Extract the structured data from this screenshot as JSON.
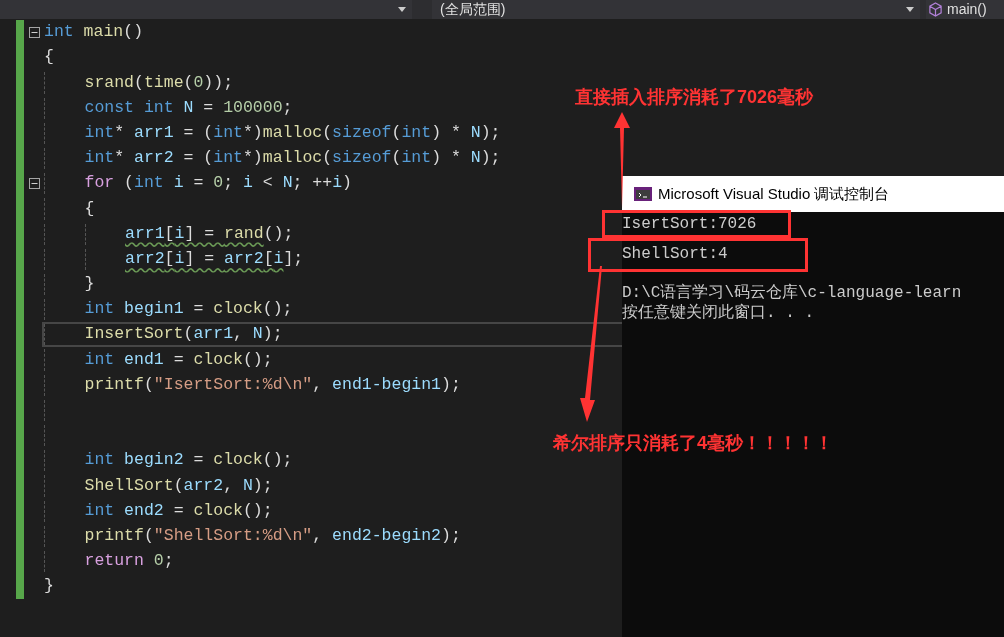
{
  "toolbar": {
    "scope": "(全局范围)",
    "member": "main()"
  },
  "editor": {
    "lines": [
      {
        "kind": "code",
        "foldable": true,
        "tokens": [
          {
            "text": "int",
            "kind": "keyword"
          },
          {
            "text": " main",
            "kind": "function"
          },
          {
            "text": "()",
            "kind": "plain"
          }
        ]
      },
      {
        "kind": "code",
        "tokens": [
          {
            "text": "{",
            "kind": "plain"
          }
        ],
        "children": [
          {
            "kind": "code",
            "tokens": [
              {
                "text": "srand",
                "kind": "function"
              },
              {
                "text": "(",
                "kind": "plain"
              },
              {
                "text": "time",
                "kind": "function"
              },
              {
                "text": "(",
                "kind": "plain"
              },
              {
                "text": "0",
                "kind": "number"
              },
              {
                "text": "));",
                "kind": "plain"
              }
            ]
          },
          {
            "kind": "code",
            "tokens": [
              {
                "text": "const int",
                "kind": "keyword"
              },
              {
                "text": " N",
                "kind": "variable"
              },
              {
                "text": " = ",
                "kind": "plain"
              },
              {
                "text": "100000",
                "kind": "number"
              },
              {
                "text": ";",
                "kind": "plain"
              }
            ]
          },
          {
            "kind": "code",
            "tokens": [
              {
                "text": "int",
                "kind": "keyword"
              },
              {
                "text": "* ",
                "kind": "plain"
              },
              {
                "text": "arr1",
                "kind": "variable"
              },
              {
                "text": " = (",
                "kind": "plain"
              },
              {
                "text": "int",
                "kind": "keyword"
              },
              {
                "text": "*)",
                "kind": "plain"
              },
              {
                "text": "malloc",
                "kind": "function"
              },
              {
                "text": "(",
                "kind": "plain"
              },
              {
                "text": "sizeof",
                "kind": "keyword"
              },
              {
                "text": "(",
                "kind": "plain"
              },
              {
                "text": "int",
                "kind": "keyword"
              },
              {
                "text": ") * ",
                "kind": "plain"
              },
              {
                "text": "N",
                "kind": "variable"
              },
              {
                "text": ");",
                "kind": "plain"
              }
            ]
          },
          {
            "kind": "code",
            "tokens": [
              {
                "text": "int",
                "kind": "keyword"
              },
              {
                "text": "* ",
                "kind": "plain"
              },
              {
                "text": "arr2",
                "kind": "variable"
              },
              {
                "text": " = (",
                "kind": "plain"
              },
              {
                "text": "int",
                "kind": "keyword"
              },
              {
                "text": "*)",
                "kind": "plain"
              },
              {
                "text": "malloc",
                "kind": "function"
              },
              {
                "text": "(",
                "kind": "plain"
              },
              {
                "text": "sizeof",
                "kind": "keyword"
              },
              {
                "text": "(",
                "kind": "plain"
              },
              {
                "text": "int",
                "kind": "keyword"
              },
              {
                "text": ") * ",
                "kind": "plain"
              },
              {
                "text": "N",
                "kind": "variable"
              },
              {
                "text": ");",
                "kind": "plain"
              }
            ]
          },
          {
            "kind": "code",
            "foldable": true,
            "tokens": [
              {
                "text": "for",
                "kind": "control"
              },
              {
                "text": " (",
                "kind": "plain"
              },
              {
                "text": "int",
                "kind": "keyword"
              },
              {
                "text": " i",
                "kind": "variable"
              },
              {
                "text": " = ",
                "kind": "plain"
              },
              {
                "text": "0",
                "kind": "number"
              },
              {
                "text": "; ",
                "kind": "plain"
              },
              {
                "text": "i",
                "kind": "variable"
              },
              {
                "text": " < ",
                "kind": "plain"
              },
              {
                "text": "N",
                "kind": "variable"
              },
              {
                "text": "; ++",
                "kind": "plain"
              },
              {
                "text": "i",
                "kind": "variable"
              },
              {
                "text": ")",
                "kind": "plain"
              }
            ]
          },
          {
            "kind": "code",
            "tokens": [
              {
                "text": "{",
                "kind": "plain"
              }
            ],
            "children": [
              {
                "kind": "code",
                "warning": true,
                "tokens": [
                  {
                    "text": "arr1",
                    "kind": "variable"
                  },
                  {
                    "text": "[",
                    "kind": "plain"
                  },
                  {
                    "text": "i",
                    "kind": "variable"
                  },
                  {
                    "text": "] = ",
                    "kind": "plain"
                  },
                  {
                    "text": "rand",
                    "kind": "function"
                  },
                  {
                    "text": "();",
                    "kind": "plain"
                  }
                ]
              },
              {
                "kind": "code",
                "warning": true,
                "tokens": [
                  {
                    "text": "arr2",
                    "kind": "variable"
                  },
                  {
                    "text": "[",
                    "kind": "plain"
                  },
                  {
                    "text": "i",
                    "kind": "variable"
                  },
                  {
                    "text": "] = ",
                    "kind": "plain"
                  },
                  {
                    "text": "arr2",
                    "kind": "variable"
                  },
                  {
                    "text": "[",
                    "kind": "plain"
                  },
                  {
                    "text": "i",
                    "kind": "variable"
                  },
                  {
                    "text": "];",
                    "kind": "plain"
                  }
                ]
              }
            ]
          },
          {
            "kind": "code",
            "tokens": [
              {
                "text": "}",
                "kind": "plain"
              }
            ]
          },
          {
            "kind": "code",
            "tokens": [
              {
                "text": "int",
                "kind": "keyword"
              },
              {
                "text": " begin1",
                "kind": "variable"
              },
              {
                "text": " = ",
                "kind": "plain"
              },
              {
                "text": "clock",
                "kind": "function"
              },
              {
                "text": "();",
                "kind": "plain"
              }
            ]
          },
          {
            "kind": "code",
            "current": true,
            "tokens": [
              {
                "text": "InsertSort",
                "kind": "function"
              },
              {
                "text": "(",
                "kind": "plain"
              },
              {
                "text": "arr1",
                "kind": "variable"
              },
              {
                "text": ", ",
                "kind": "plain"
              },
              {
                "text": "N",
                "kind": "variable"
              },
              {
                "text": ");",
                "kind": "plain"
              }
            ]
          },
          {
            "kind": "code",
            "tokens": [
              {
                "text": "int",
                "kind": "keyword"
              },
              {
                "text": " end1",
                "kind": "variable"
              },
              {
                "text": " = ",
                "kind": "plain"
              },
              {
                "text": "clock",
                "kind": "function"
              },
              {
                "text": "();",
                "kind": "plain"
              }
            ]
          },
          {
            "kind": "code",
            "tokens": [
              {
                "text": "printf",
                "kind": "function"
              },
              {
                "text": "(",
                "kind": "plain"
              },
              {
                "text": "\"IsertSort:%d\\n\"",
                "kind": "string"
              },
              {
                "text": ", ",
                "kind": "plain"
              },
              {
                "text": "end1-begin1",
                "kind": "variable"
              },
              {
                "text": ");",
                "kind": "plain"
              }
            ]
          },
          {
            "kind": "blank"
          },
          {
            "kind": "blank"
          },
          {
            "kind": "code",
            "tokens": [
              {
                "text": "int",
                "kind": "keyword"
              },
              {
                "text": " begin2",
                "kind": "variable"
              },
              {
                "text": " = ",
                "kind": "plain"
              },
              {
                "text": "clock",
                "kind": "function"
              },
              {
                "text": "();",
                "kind": "plain"
              }
            ]
          },
          {
            "kind": "code",
            "tokens": [
              {
                "text": "ShellSort",
                "kind": "function"
              },
              {
                "text": "(",
                "kind": "plain"
              },
              {
                "text": "arr2",
                "kind": "variable"
              },
              {
                "text": ", ",
                "kind": "plain"
              },
              {
                "text": "N",
                "kind": "variable"
              },
              {
                "text": ");",
                "kind": "plain"
              }
            ]
          },
          {
            "kind": "code",
            "tokens": [
              {
                "text": "int",
                "kind": "keyword"
              },
              {
                "text": " end2",
                "kind": "variable"
              },
              {
                "text": " = ",
                "kind": "plain"
              },
              {
                "text": "clock",
                "kind": "function"
              },
              {
                "text": "();",
                "kind": "plain"
              }
            ]
          },
          {
            "kind": "code",
            "tokens": [
              {
                "text": "printf",
                "kind": "function"
              },
              {
                "text": "(",
                "kind": "plain"
              },
              {
                "text": "\"ShellSort:%d\\n\"",
                "kind": "string"
              },
              {
                "text": ", ",
                "kind": "plain"
              },
              {
                "text": "end2-begin2",
                "kind": "variable"
              },
              {
                "text": ");",
                "kind": "plain"
              }
            ]
          },
          {
            "kind": "code",
            "tokens": [
              {
                "text": "return",
                "kind": "control"
              },
              {
                "text": " 0",
                "kind": "number"
              },
              {
                "text": ";",
                "kind": "plain"
              }
            ]
          }
        ]
      },
      {
        "kind": "code",
        "tokens": [
          {
            "text": "}",
            "kind": "plain"
          }
        ]
      }
    ]
  },
  "console": {
    "title": "Microsoft Visual Studio 调试控制台",
    "blocks": [
      [
        "IsertSort:7026",
        "ShellSort:4"
      ],
      [
        "D:\\C语言学习\\码云仓库\\c-language-learn",
        "按任意键关闭此窗口. . ."
      ]
    ]
  },
  "annotations": {
    "top_note": "直接插入排序消耗了7026毫秒",
    "bottom_note": "希尔排序只消耗了4毫秒！！！！！"
  }
}
